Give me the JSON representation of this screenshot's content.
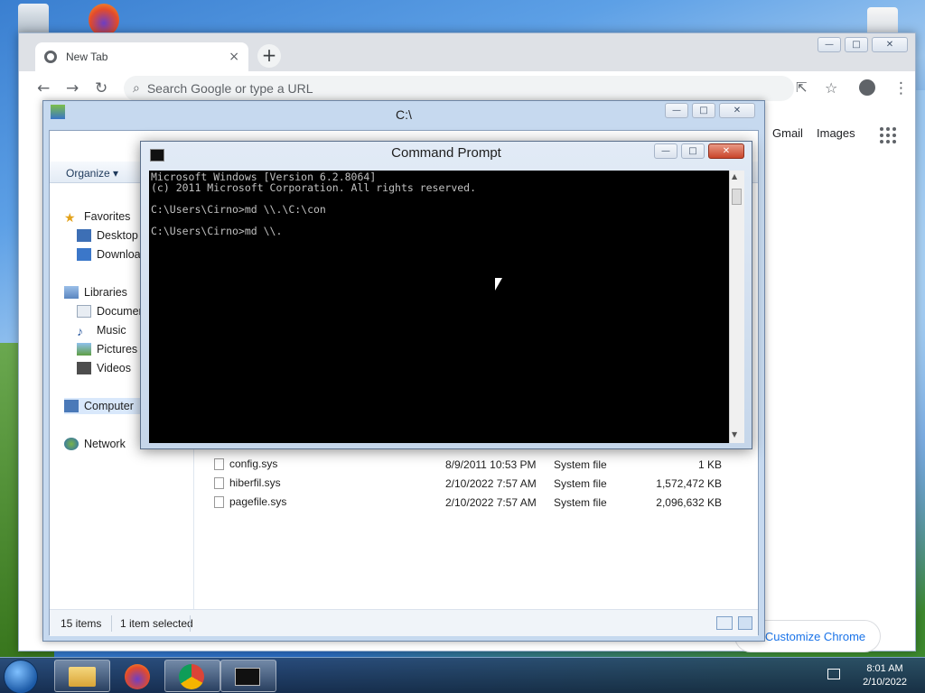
{
  "chrome": {
    "tab_title": "New Tab",
    "tab_close": "×",
    "new_tab": "+",
    "search_placeholder": "Search Google or type a URL",
    "gmail": "Gmail",
    "images": "Images",
    "customize": "Customize Chrome"
  },
  "explorer": {
    "title": "C:\\",
    "organize": "Organize ▾",
    "nav": {
      "favorites": "Favorites",
      "desktop": "Desktop",
      "downloads": "Downloads",
      "libraries": "Libraries",
      "documents": "Documents",
      "music": "Music",
      "pictures": "Pictures",
      "videos": "Videos",
      "computer": "Computer",
      "network": "Network"
    },
    "files": [
      {
        "name": "config.sys",
        "date": "8/9/2011 10:53 PM",
        "type": "System file",
        "size": "1 KB"
      },
      {
        "name": "hiberfil.sys",
        "date": "2/10/2022 7:57 AM",
        "type": "System file",
        "size": "1,572,472 KB"
      },
      {
        "name": "pagefile.sys",
        "date": "2/10/2022 7:57 AM",
        "type": "System file",
        "size": "2,096,632 KB"
      }
    ],
    "status": {
      "items": "15 items",
      "selected": "1 item selected"
    }
  },
  "cmd": {
    "title": "Command Prompt",
    "lines": [
      "Microsoft Windows [Version 6.2.8064]",
      "(c) 2011 Microsoft Corporation. All rights reserved.",
      "",
      "C:\\Users\\Cirno>md \\\\.\\C:\\con",
      "",
      "C:\\Users\\Cirno>md \\\\."
    ]
  },
  "taskbar": {
    "time": "8:01 AM",
    "date": "2/10/2022"
  }
}
